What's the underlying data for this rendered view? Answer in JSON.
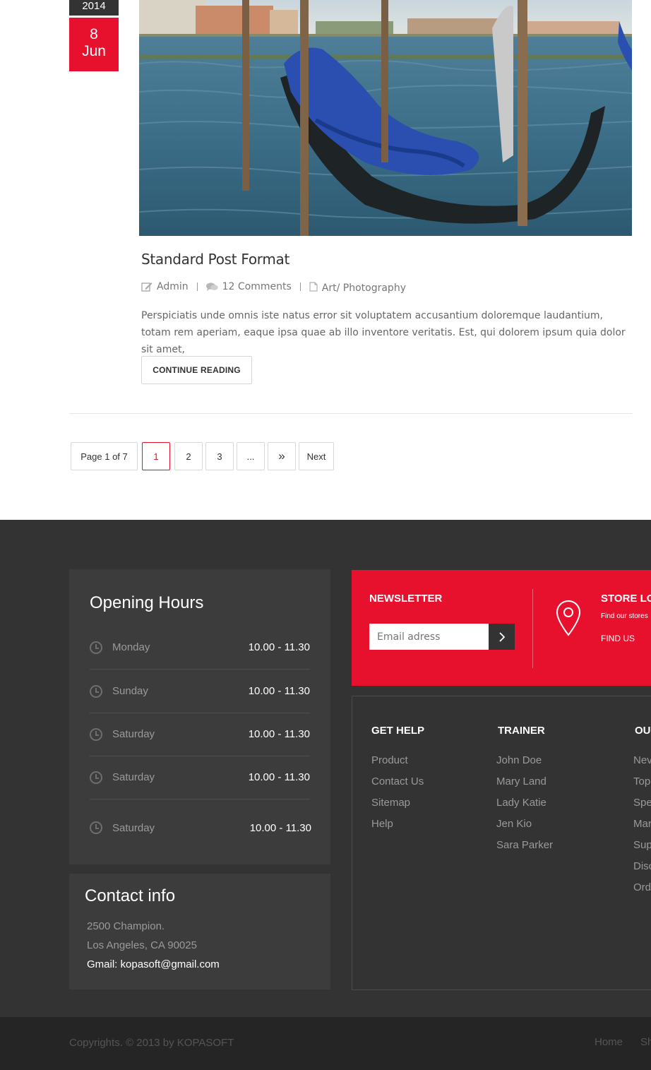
{
  "post": {
    "date_year": "2014",
    "date_day": "8",
    "date_month": "Jun",
    "title": "Standard Post Format",
    "author": "Admin",
    "comments": "12 Comments",
    "category": "Art/ Photography",
    "excerpt": "Perspiciatis unde omnis iste natus error sit voluptatem accusantium doloremque laudantium, totam rem aperiam, eaque ipsa quae ab illo inventore veritatis. Est, qui dolorem ipsum quia dolor sit amet,",
    "read_more": "CONTINUE READING"
  },
  "pagination": {
    "summary": "Page 1 of 7",
    "pages": [
      "1",
      "2",
      "3",
      "..."
    ],
    "next_arrow": "»",
    "next": "Next",
    "active_page": "1"
  },
  "opening_hours": {
    "title": "Opening Hours",
    "rows": [
      {
        "day": "Monday",
        "time": "10.00 - 11.30"
      },
      {
        "day": "Sunday",
        "time": "10.00 - 11.30"
      },
      {
        "day": "Saturday",
        "time": "10.00 - 11.30"
      },
      {
        "day": "Saturday",
        "time": "10.00 - 11.30"
      },
      {
        "day": "Saturday",
        "time": "10.00 - 11.30"
      }
    ]
  },
  "contact": {
    "title": "Contact info",
    "address1": "2500 Champion.",
    "address2": "Los Angeles, CA 90025",
    "email": "Gmail: kopasoft@gmail.com"
  },
  "newsletter": {
    "title": "NEWSLETTER",
    "placeholder": "Email adress"
  },
  "store": {
    "title": "STORE LO",
    "subtitle": "Find our stores",
    "link": "FIND US"
  },
  "footer_columns": {
    "get_help": {
      "title": "GET HELP",
      "items": [
        "Product",
        "Contact Us",
        "Sitemap",
        "Help"
      ]
    },
    "trainer": {
      "title": "TRAINER",
      "items": [
        "John Doe",
        "Mary Land",
        "Lady Katie",
        "Jen Kio",
        "Sara Parker"
      ]
    },
    "third": {
      "title": "OU",
      "items": [
        "Nev",
        "Top",
        "Spe",
        "Mar",
        "Sup",
        "Disc",
        "Ord"
      ]
    }
  },
  "bottom": {
    "copyright": "Copyrights. © 2013 by KOPASOFT",
    "links": [
      "Home",
      "Sh"
    ]
  },
  "colors": {
    "accent": "#e8112d",
    "footer_bg": "#333333",
    "panel_bg": "#3c3c3c",
    "bottom_bg": "#252525"
  }
}
